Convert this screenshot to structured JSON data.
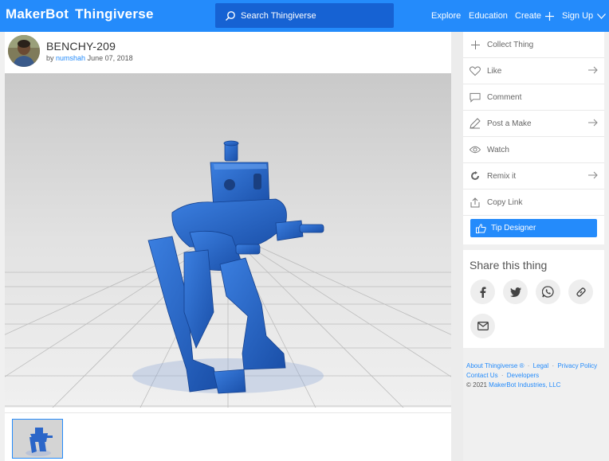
{
  "header": {
    "brand_maker": "MakerBot",
    "brand_thing": "Thingiverse",
    "search_placeholder": "Search Thingiverse",
    "nav": {
      "explore": "Explore",
      "education": "Education",
      "create": "Create",
      "signup": "Sign Up"
    }
  },
  "thing": {
    "title": "BENCHY-209",
    "by": "by",
    "author": "numshah",
    "date": "June 07, 2018"
  },
  "actions": {
    "collect": "Collect Thing",
    "like": "Like",
    "comment": "Comment",
    "post_make": "Post a Make",
    "watch": "Watch",
    "remix": "Remix it",
    "copy_link": "Copy Link",
    "tip": "Tip Designer"
  },
  "share": {
    "title": "Share this thing",
    "icons": [
      "facebook-icon",
      "twitter-icon",
      "whatsapp-icon",
      "link-icon",
      "email-icon"
    ]
  },
  "footer": {
    "about": "About Thingiverse",
    "about_mark": "®",
    "legal": "Legal",
    "privacy": "Privacy Policy",
    "contact": "Contact Us",
    "developers": "Developers",
    "copyright": "©",
    "year": "2021",
    "company": "MakerBot Industries, LLC"
  },
  "colors": {
    "brand_blue": "#248bfb",
    "search_bg": "#1662d3",
    "model_blue": "#1f5fc4"
  }
}
